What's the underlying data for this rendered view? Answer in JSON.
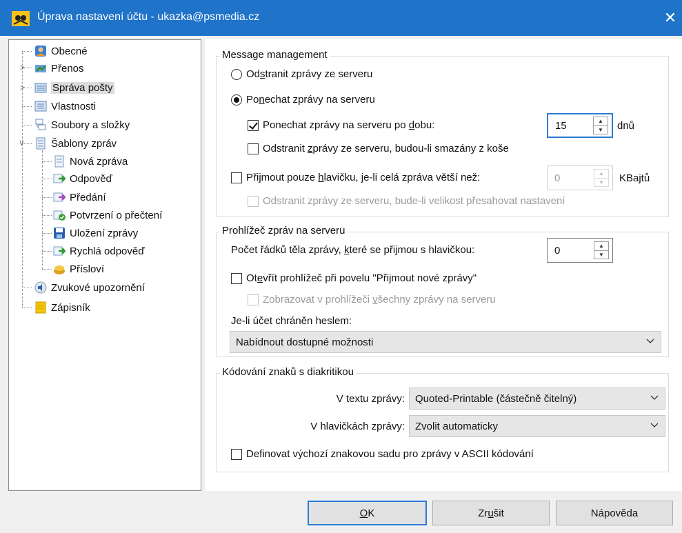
{
  "window": {
    "title": "Úprava nastavení účtu - ukazka@psmedia.cz",
    "close_symbol": "✕"
  },
  "tree": {
    "items": [
      {
        "label": "Obecné",
        "icon": "user-icon"
      },
      {
        "label": "Přenos",
        "icon": "transfer-icon"
      },
      {
        "label": "Správa pošty",
        "icon": "mail-management-icon"
      },
      {
        "label": "Vlastnosti",
        "icon": "properties-icon"
      },
      {
        "label": "Soubory a složky",
        "icon": "folders-icon"
      },
      {
        "label": "Šablony zpráv",
        "icon": "templates-icon"
      },
      {
        "label": "Nová zpráva",
        "icon": "new-message-icon"
      },
      {
        "label": "Odpověď",
        "icon": "reply-icon"
      },
      {
        "label": "Předání",
        "icon": "forward-icon"
      },
      {
        "label": "Potvrzení o přečtení",
        "icon": "read-receipt-icon"
      },
      {
        "label": "Uložení zprávy",
        "icon": "save-message-icon"
      },
      {
        "label": "Rychlá odpověď",
        "icon": "quick-reply-icon"
      },
      {
        "label": "Přísloví",
        "icon": "proverb-icon"
      },
      {
        "label": "Zvukové upozornění",
        "icon": "speaker-icon"
      },
      {
        "label": "Zápisník",
        "icon": "notepad-icon"
      }
    ],
    "selected": "Správa pošty"
  },
  "message_management": {
    "title": "Message management",
    "remove_pre": "Od",
    "remove_u": "s",
    "remove_post": "tranit zprávy ze serveru",
    "keep_pre": "Po",
    "keep_u": "n",
    "keep_post": "echat zprávy na serveru",
    "keep_days_pre": "Ponechat zprávy na serveru po ",
    "keep_days_u": "d",
    "keep_days_post": "obu:",
    "keep_days_value": "15",
    "keep_days_unit": "dnů",
    "remove_trash_pre": "Odstranit ",
    "remove_trash_u": "z",
    "remove_trash_post": "právy ze serveru, budou-li smazány z koše",
    "headers_only_pre": "Přijmout pouze ",
    "headers_only_u": "h",
    "headers_only_post": "lavičku, je-li celá zpráva větší než:",
    "headers_only_value": "0",
    "headers_only_unit": "KBajtů",
    "remove_size": "Odstranit zprávy ze serveru, bude-li velikost přesahovat nastavení"
  },
  "server_browser": {
    "title": "Prohlížeč zpráv na serveru",
    "lines_pre": "Počet řádků těla zprávy, ",
    "lines_u": "k",
    "lines_post": "teré se přijmou s hlavičkou:",
    "lines_value": "0",
    "open_pre": "Ot",
    "open_u": "e",
    "open_post": "vřít prohlížeč při povelu \"Přijmout nové zprávy\"",
    "show_all_pre": "Zobrazovat v prohlížeči ",
    "show_all_u": "v",
    "show_all_post": "šechny zprávy na serveru",
    "password_label": "Je-li účet chráněn heslem:",
    "password_value": "Nabídnout dostupné možnosti"
  },
  "encoding": {
    "title": "Kódování znaků s diakritikou",
    "body_label": "V textu zprávy:",
    "body_value": "Quoted-Printable (částečně čitelný)",
    "header_label": "V hlavičkách zprávy:",
    "header_value": "Zvolit automaticky",
    "define_charset": "Definovat výchozí znakovou sadu pro zprávy v ASCII kódování"
  },
  "buttons": {
    "ok_u": "O",
    "ok_post": "K",
    "cancel_pre": "Zr",
    "cancel_u": "u",
    "cancel_post": "šit",
    "help": "Nápověda"
  },
  "colors": {
    "titlebar": "#1f73c8",
    "focus": "#2c7ad6"
  }
}
